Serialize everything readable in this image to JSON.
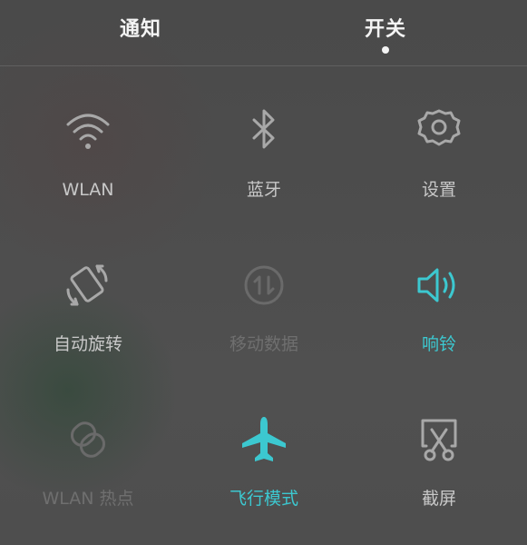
{
  "tabs": {
    "notifications": "通知",
    "toggles": "开关",
    "active": "toggles"
  },
  "tiles": [
    {
      "label": "WLAN",
      "icon": "wifi-icon",
      "state": "normal"
    },
    {
      "label": "蓝牙",
      "icon": "bluetooth-icon",
      "state": "normal"
    },
    {
      "label": "设置",
      "icon": "gear-icon",
      "state": "normal"
    },
    {
      "label": "自动旋转",
      "icon": "auto-rotate-icon",
      "state": "normal"
    },
    {
      "label": "移动数据",
      "icon": "mobile-data-icon",
      "state": "off"
    },
    {
      "label": "响铃",
      "icon": "speaker-icon",
      "state": "on"
    },
    {
      "label": "WLAN 热点",
      "icon": "hotspot-icon",
      "state": "off"
    },
    {
      "label": "飞行模式",
      "icon": "airplane-icon",
      "state": "on"
    },
    {
      "label": "截屏",
      "icon": "screenshot-icon",
      "state": "normal"
    }
  ],
  "colors": {
    "accent": "#3cc8d0",
    "text_normal": "#c8c8c8",
    "text_off": "#6f6f6f",
    "header_text": "#f4f4f4"
  }
}
